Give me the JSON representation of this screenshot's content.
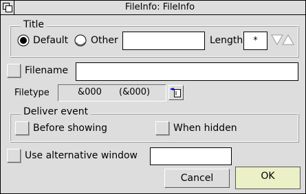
{
  "window": {
    "title": "FileInfo: FileInfo"
  },
  "title_group": {
    "label": "Title",
    "default_label": "Default",
    "other_label": "Other",
    "other_value": "",
    "length_label": "Length",
    "length_value": "*"
  },
  "filename": {
    "label": "Filename",
    "value": ""
  },
  "filetype": {
    "label": "Filetype",
    "hex": "&000",
    "paren": "(&000)"
  },
  "deliver_event": {
    "label": "Deliver event",
    "before_label": "Before showing",
    "hidden_label": "When hidden"
  },
  "alt_window": {
    "label": "Use alternative window",
    "value": ""
  },
  "buttons": {
    "cancel": "Cancel",
    "ok": "OK"
  },
  "colors": {
    "background": "#dddddd",
    "ok_highlight": "#ecf0c6"
  }
}
